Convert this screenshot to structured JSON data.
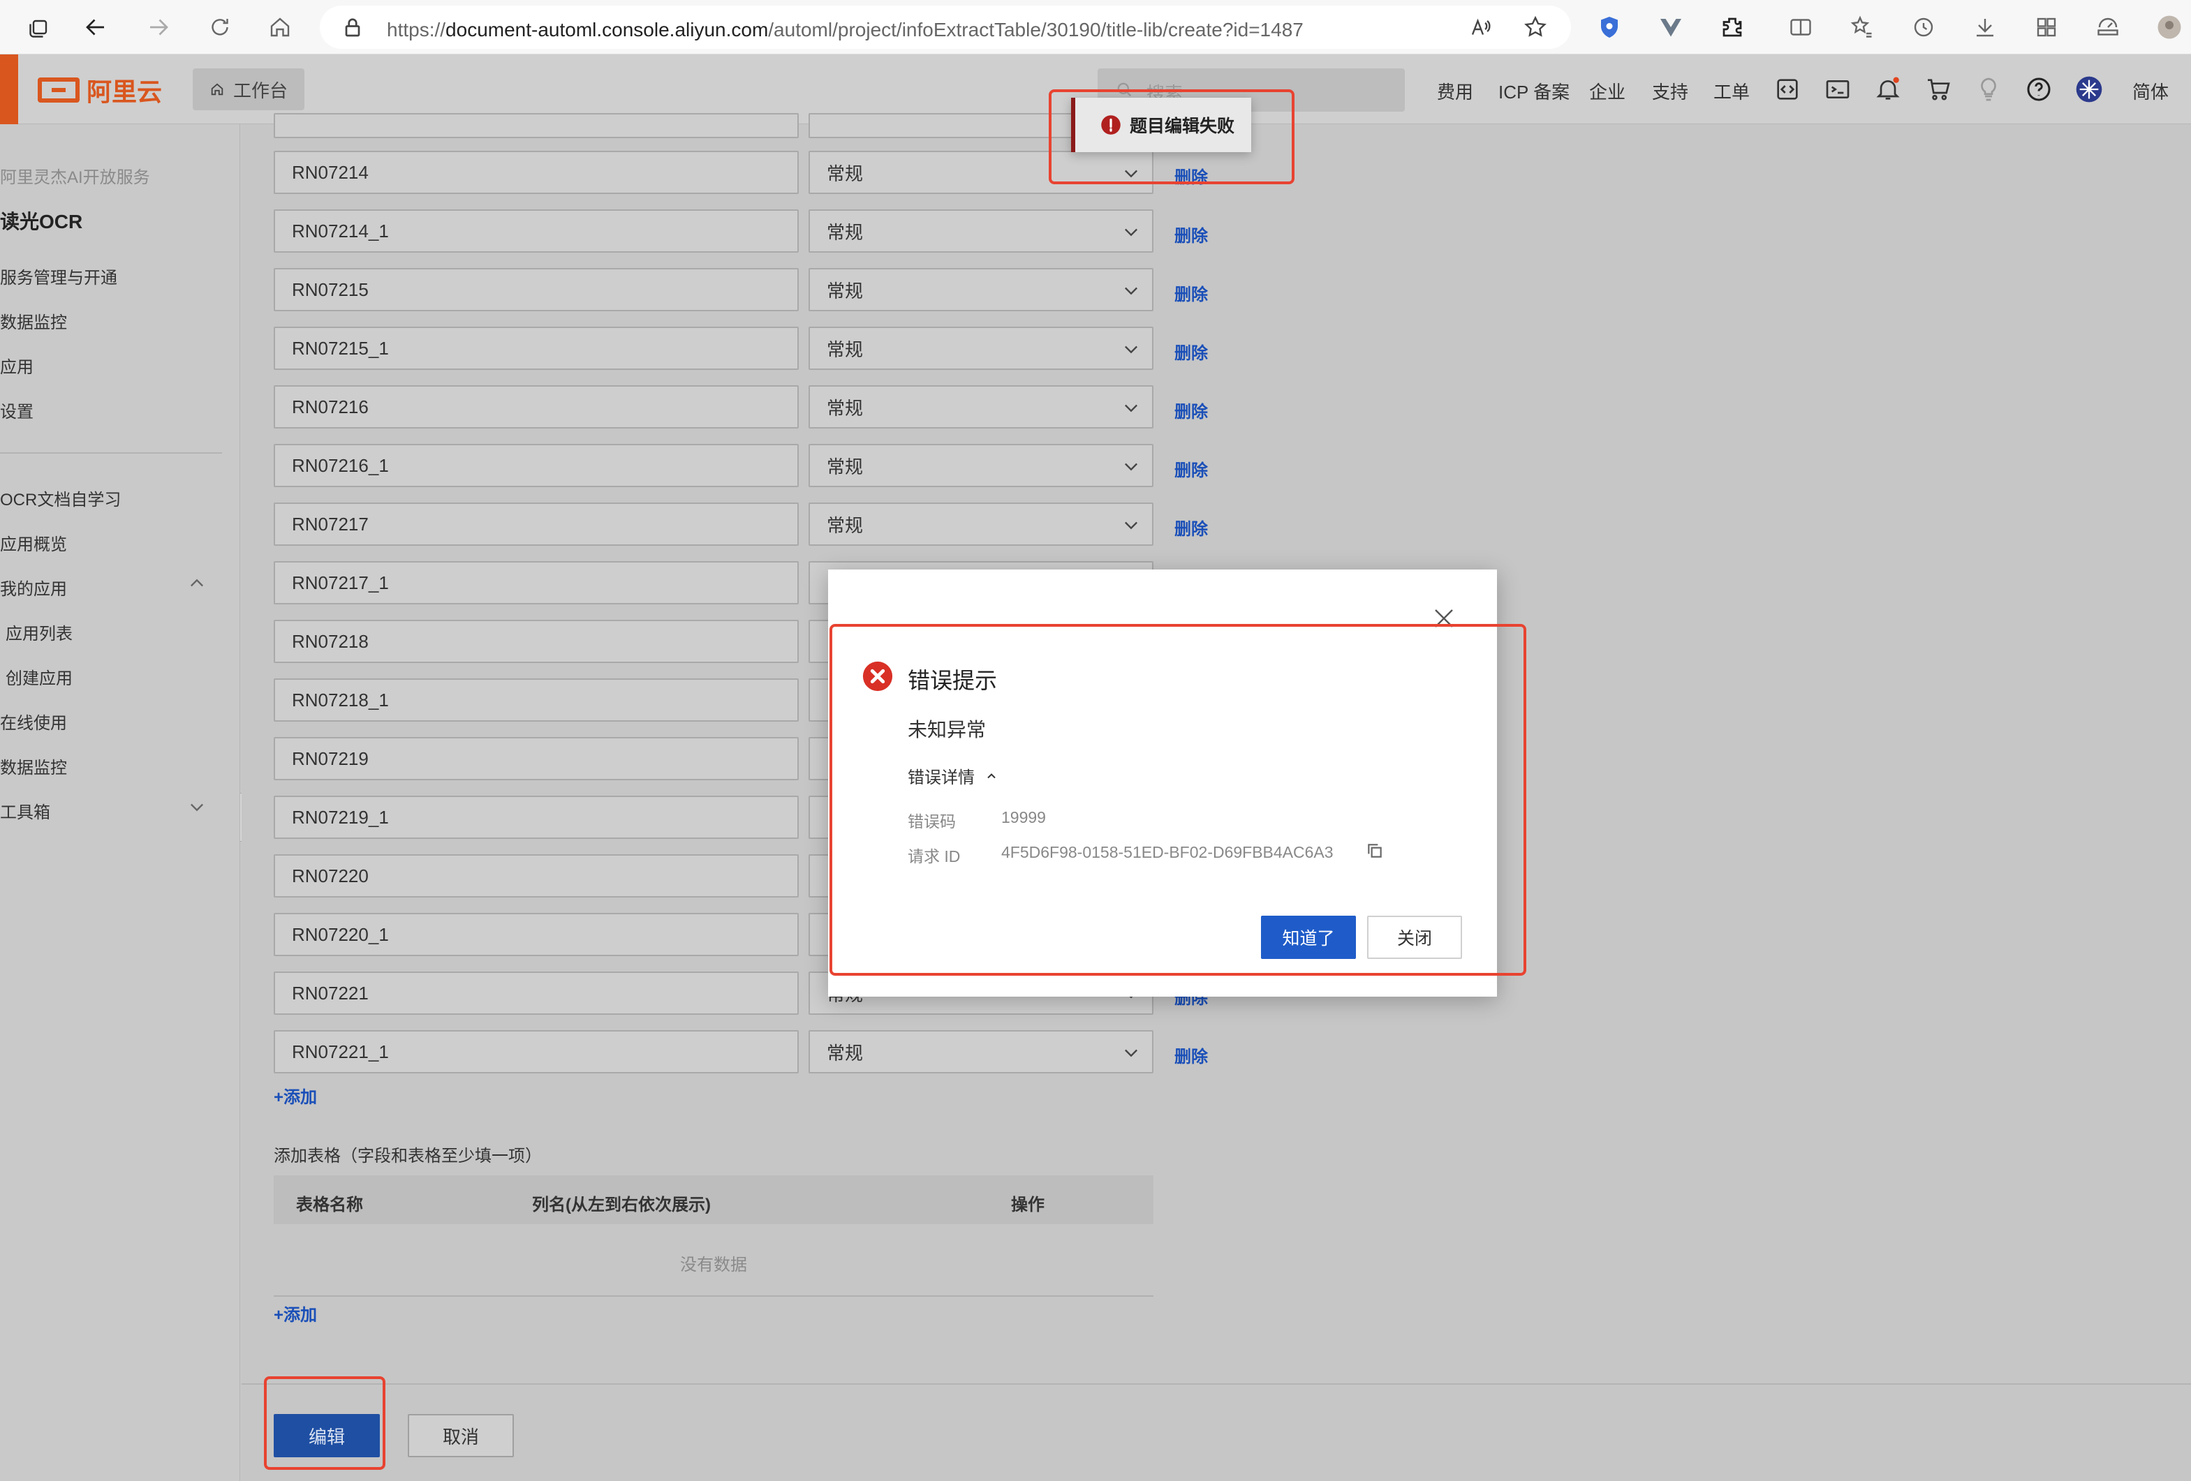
{
  "browser": {
    "url_prefix": "https://",
    "url_domain": "document-automl.console.aliyun.com",
    "url_path": "/automl/project/infoExtractTable/30190/title-lib/create?id=1487"
  },
  "topnav": {
    "brand": "阿里云",
    "workbench": "工作台",
    "search_placeholder": "搜索...",
    "links": [
      "费用",
      "ICP 备案",
      "企业",
      "支持",
      "工单"
    ],
    "language": "简体"
  },
  "sidebar": {
    "service_group": "阿里灵杰AI开放服务",
    "product": "读光OCR",
    "items_top": [
      "服务管理与开通",
      "数据监控",
      "应用",
      "设置"
    ],
    "section2_title": "OCR文档自学习",
    "items_bottom": [
      "应用概览",
      "我的应用",
      "应用列表",
      "创建应用",
      "在线使用",
      "数据监控",
      "工具箱"
    ]
  },
  "form": {
    "rows": [
      {
        "name": "RN07214",
        "type": "常规",
        "action": "删除"
      },
      {
        "name": "RN07214_1",
        "type": "常规",
        "action": "删除"
      },
      {
        "name": "RN07215",
        "type": "常规",
        "action": "删除"
      },
      {
        "name": "RN07215_1",
        "type": "常规",
        "action": "删除"
      },
      {
        "name": "RN07216",
        "type": "常规",
        "action": "删除"
      },
      {
        "name": "RN07216_1",
        "type": "常规",
        "action": "删除"
      },
      {
        "name": "RN07217",
        "type": "常规",
        "action": "删除"
      },
      {
        "name": "RN07217_1",
        "type": "",
        "action": ""
      },
      {
        "name": "RN07218",
        "type": "",
        "action": ""
      },
      {
        "name": "RN07218_1",
        "type": "",
        "action": ""
      },
      {
        "name": "RN07219",
        "type": "",
        "action": ""
      },
      {
        "name": "RN07219_1",
        "type": "",
        "action": ""
      },
      {
        "name": "RN07220",
        "type": "",
        "action": ""
      },
      {
        "name": "RN07220_1",
        "type": "",
        "action": ""
      },
      {
        "name": "RN07221",
        "type": "常规",
        "action": "删除"
      },
      {
        "name": "RN07221_1",
        "type": "常规",
        "action": "删除"
      }
    ],
    "add_field": "+添加",
    "table_section_title": "添加表格（字段和表格至少填一项）",
    "table_headers": [
      "表格名称",
      "列名(从左到右依次展示)",
      "操作"
    ],
    "table_empty": "没有数据",
    "add_table": "+添加",
    "edit_button": "编辑",
    "cancel_button": "取消"
  },
  "toast": {
    "message": "题目编辑失败"
  },
  "modal": {
    "title": "错误提示",
    "message": "未知异常",
    "details_toggle": "错误详情",
    "error_code_label": "错误码",
    "error_code": "19999",
    "request_id_label": "请求 ID",
    "request_id": "4F5D6F98-0158-51ED-BF02-D69FBB4AC6A3",
    "ok_button": "知道了",
    "close_button": "关闭"
  },
  "colors": {
    "brand_orange": "#d9561e",
    "link_blue": "#1a4fb8",
    "primary_blue": "#1f5cc9",
    "error_red": "#d93026",
    "annotation_red": "#e84331"
  }
}
